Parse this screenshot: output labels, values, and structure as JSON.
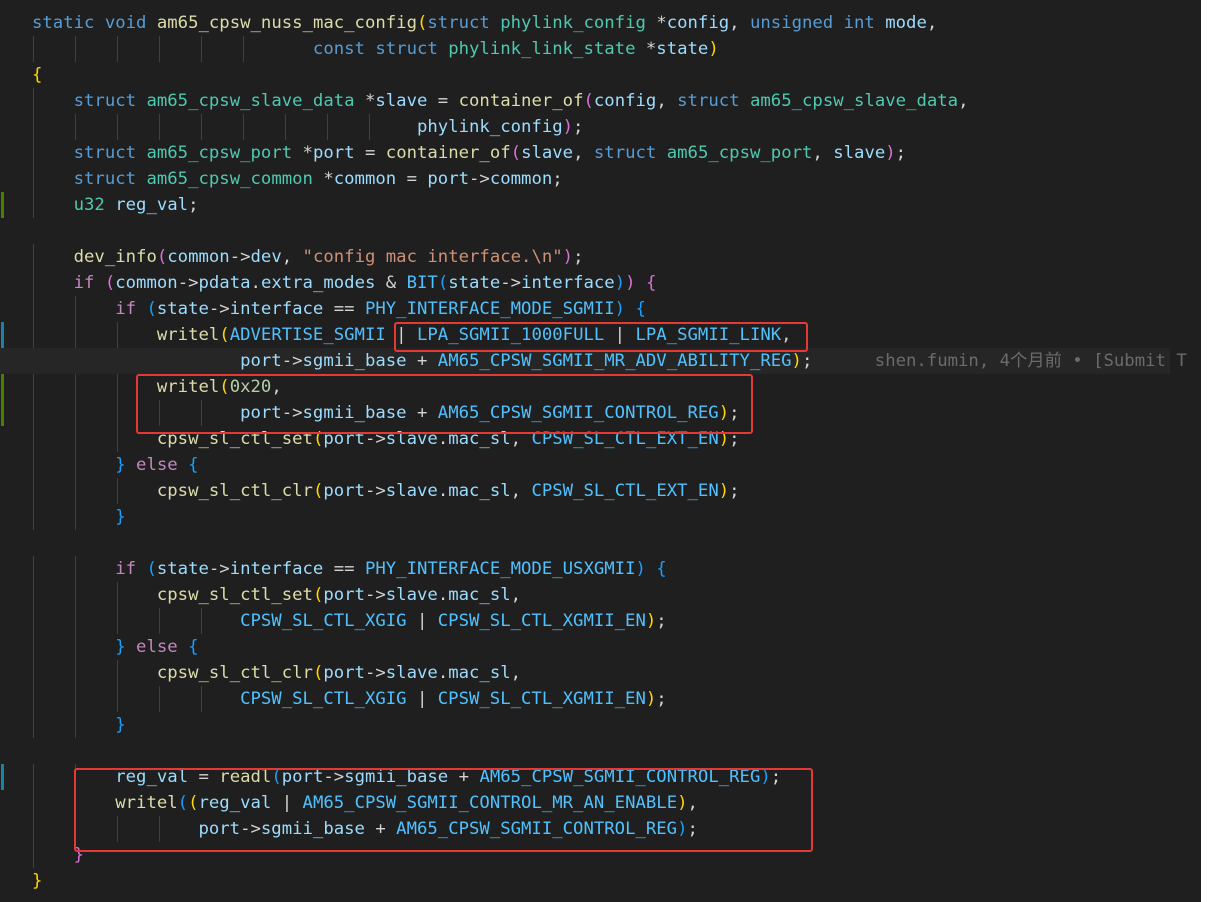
{
  "editor": {
    "language": "c",
    "theme": "dark",
    "blame_annotation": "shen.fumin, 4个月前 • [Submit T",
    "lines": [
      [
        [
          "kw",
          "static "
        ],
        [
          "kw",
          "void "
        ],
        [
          "fn",
          "am65_cpsw_nuss_mac_config"
        ],
        [
          "b1",
          "("
        ],
        [
          "kw",
          "struct "
        ],
        [
          "ty",
          "phylink_config "
        ],
        [
          "op",
          "*"
        ],
        [
          "var",
          "config"
        ],
        [
          "op",
          ", "
        ],
        [
          "kw",
          "unsigned "
        ],
        [
          "kw",
          "int "
        ],
        [
          "var",
          "mode"
        ],
        [
          "op",
          ","
        ]
      ],
      [
        [
          "op",
          "                           "
        ],
        [
          "kw",
          "const "
        ],
        [
          "kw",
          "struct "
        ],
        [
          "ty",
          "phylink_link_state "
        ],
        [
          "op",
          "*"
        ],
        [
          "var",
          "state"
        ],
        [
          "b1",
          ")"
        ]
      ],
      [
        [
          "b1",
          "{"
        ]
      ],
      [
        [
          "op",
          "    "
        ],
        [
          "kw",
          "struct "
        ],
        [
          "ty",
          "am65_cpsw_slave_data "
        ],
        [
          "op",
          "*"
        ],
        [
          "var",
          "slave"
        ],
        [
          "op",
          " = "
        ],
        [
          "fn",
          "container_of"
        ],
        [
          "b2",
          "("
        ],
        [
          "var",
          "config"
        ],
        [
          "op",
          ", "
        ],
        [
          "kw",
          "struct "
        ],
        [
          "ty",
          "am65_cpsw_slave_data"
        ],
        [
          "op",
          ","
        ]
      ],
      [
        [
          "op",
          "                                     "
        ],
        [
          "var",
          "phylink_config"
        ],
        [
          "b2",
          ")"
        ],
        [
          "op",
          ";"
        ]
      ],
      [
        [
          "op",
          "    "
        ],
        [
          "kw",
          "struct "
        ],
        [
          "ty",
          "am65_cpsw_port "
        ],
        [
          "op",
          "*"
        ],
        [
          "var",
          "port"
        ],
        [
          "op",
          " = "
        ],
        [
          "fn",
          "container_of"
        ],
        [
          "b2",
          "("
        ],
        [
          "var",
          "slave"
        ],
        [
          "op",
          ", "
        ],
        [
          "kw",
          "struct "
        ],
        [
          "ty",
          "am65_cpsw_port"
        ],
        [
          "op",
          ", "
        ],
        [
          "var",
          "slave"
        ],
        [
          "b2",
          ")"
        ],
        [
          "op",
          ";"
        ]
      ],
      [
        [
          "op",
          "    "
        ],
        [
          "kw",
          "struct "
        ],
        [
          "ty",
          "am65_cpsw_common "
        ],
        [
          "op",
          "*"
        ],
        [
          "var",
          "common"
        ],
        [
          "op",
          " = "
        ],
        [
          "var",
          "port"
        ],
        [
          "op",
          "->"
        ],
        [
          "var",
          "common"
        ],
        [
          "op",
          ";"
        ]
      ],
      [
        [
          "op",
          "    "
        ],
        [
          "ty",
          "u32 "
        ],
        [
          "var",
          "reg_val"
        ],
        [
          "op",
          ";"
        ]
      ],
      [],
      [
        [
          "op",
          "    "
        ],
        [
          "fn",
          "dev_info"
        ],
        [
          "b2",
          "("
        ],
        [
          "var",
          "common"
        ],
        [
          "op",
          "->"
        ],
        [
          "var",
          "dev"
        ],
        [
          "op",
          ", "
        ],
        [
          "str",
          "\"config mac interface.\\n\""
        ],
        [
          "b2",
          ")"
        ],
        [
          "op",
          ";"
        ]
      ],
      [
        [
          "op",
          "    "
        ],
        [
          "ctl",
          "if "
        ],
        [
          "b2",
          "("
        ],
        [
          "var",
          "common"
        ],
        [
          "op",
          "->"
        ],
        [
          "var",
          "pdata"
        ],
        [
          "op",
          "."
        ],
        [
          "var",
          "extra_modes"
        ],
        [
          "op",
          " & "
        ],
        [
          "mac",
          "BIT"
        ],
        [
          "b3",
          "("
        ],
        [
          "var",
          "state"
        ],
        [
          "op",
          "->"
        ],
        [
          "var",
          "interface"
        ],
        [
          "b3",
          ")"
        ],
        [
          "b2",
          ")"
        ],
        [
          "op",
          " "
        ],
        [
          "b2",
          "{"
        ]
      ],
      [
        [
          "op",
          "        "
        ],
        [
          "ctl",
          "if "
        ],
        [
          "b3",
          "("
        ],
        [
          "var",
          "state"
        ],
        [
          "op",
          "->"
        ],
        [
          "var",
          "interface"
        ],
        [
          "op",
          " == "
        ],
        [
          "mac",
          "PHY_INTERFACE_MODE_SGMII"
        ],
        [
          "b3",
          ")"
        ],
        [
          "op",
          " "
        ],
        [
          "b3",
          "{"
        ]
      ],
      [
        [
          "op",
          "            "
        ],
        [
          "fn",
          "writel"
        ],
        [
          "b1",
          "("
        ],
        [
          "mac",
          "ADVERTISE_SGMII"
        ],
        [
          "op",
          " | "
        ],
        [
          "mac",
          "LPA_SGMII_1000FULL"
        ],
        [
          "op",
          " | "
        ],
        [
          "mac",
          "LPA_SGMII_LINK"
        ],
        [
          "op",
          ","
        ]
      ],
      [
        [
          "op",
          "                    "
        ],
        [
          "var",
          "port"
        ],
        [
          "op",
          "->"
        ],
        [
          "var",
          "sgmii_base"
        ],
        [
          "op",
          " + "
        ],
        [
          "mac",
          "AM65_CPSW_SGMII_MR_ADV_ABILITY_REG"
        ],
        [
          "b1",
          ")"
        ],
        [
          "op",
          ";"
        ]
      ],
      [
        [
          "op",
          "            "
        ],
        [
          "fn",
          "writel"
        ],
        [
          "b1",
          "("
        ],
        [
          "num",
          "0x20"
        ],
        [
          "op",
          ","
        ]
      ],
      [
        [
          "op",
          "                    "
        ],
        [
          "var",
          "port"
        ],
        [
          "op",
          "->"
        ],
        [
          "var",
          "sgmii_base"
        ],
        [
          "op",
          " + "
        ],
        [
          "mac",
          "AM65_CPSW_SGMII_CONTROL_REG"
        ],
        [
          "b1",
          ")"
        ],
        [
          "op",
          ";"
        ]
      ],
      [
        [
          "op",
          "            "
        ],
        [
          "fn",
          "cpsw_sl_ctl_set"
        ],
        [
          "b1",
          "("
        ],
        [
          "var",
          "port"
        ],
        [
          "op",
          "->"
        ],
        [
          "var",
          "slave"
        ],
        [
          "op",
          "."
        ],
        [
          "var",
          "mac_sl"
        ],
        [
          "op",
          ", "
        ],
        [
          "mac",
          "CPSW_SL_CTL_EXT_EN"
        ],
        [
          "b1",
          ")"
        ],
        [
          "op",
          ";"
        ]
      ],
      [
        [
          "op",
          "        "
        ],
        [
          "b3",
          "}"
        ],
        [
          "op",
          " "
        ],
        [
          "ctl",
          "else "
        ],
        [
          "b3",
          "{"
        ]
      ],
      [
        [
          "op",
          "            "
        ],
        [
          "fn",
          "cpsw_sl_ctl_clr"
        ],
        [
          "b1",
          "("
        ],
        [
          "var",
          "port"
        ],
        [
          "op",
          "->"
        ],
        [
          "var",
          "slave"
        ],
        [
          "op",
          "."
        ],
        [
          "var",
          "mac_sl"
        ],
        [
          "op",
          ", "
        ],
        [
          "mac",
          "CPSW_SL_CTL_EXT_EN"
        ],
        [
          "b1",
          ")"
        ],
        [
          "op",
          ";"
        ]
      ],
      [
        [
          "op",
          "        "
        ],
        [
          "b3",
          "}"
        ]
      ],
      [],
      [
        [
          "op",
          "        "
        ],
        [
          "ctl",
          "if "
        ],
        [
          "b3",
          "("
        ],
        [
          "var",
          "state"
        ],
        [
          "op",
          "->"
        ],
        [
          "var",
          "interface"
        ],
        [
          "op",
          " == "
        ],
        [
          "mac",
          "PHY_INTERFACE_MODE_USXGMII"
        ],
        [
          "b3",
          ")"
        ],
        [
          "op",
          " "
        ],
        [
          "b3",
          "{"
        ]
      ],
      [
        [
          "op",
          "            "
        ],
        [
          "fn",
          "cpsw_sl_ctl_set"
        ],
        [
          "b1",
          "("
        ],
        [
          "var",
          "port"
        ],
        [
          "op",
          "->"
        ],
        [
          "var",
          "slave"
        ],
        [
          "op",
          "."
        ],
        [
          "var",
          "mac_sl"
        ],
        [
          "op",
          ","
        ]
      ],
      [
        [
          "op",
          "                    "
        ],
        [
          "mac",
          "CPSW_SL_CTL_XGIG"
        ],
        [
          "op",
          " | "
        ],
        [
          "mac",
          "CPSW_SL_CTL_XGMII_EN"
        ],
        [
          "b1",
          ")"
        ],
        [
          "op",
          ";"
        ]
      ],
      [
        [
          "op",
          "        "
        ],
        [
          "b3",
          "}"
        ],
        [
          "op",
          " "
        ],
        [
          "ctl",
          "else "
        ],
        [
          "b3",
          "{"
        ]
      ],
      [
        [
          "op",
          "            "
        ],
        [
          "fn",
          "cpsw_sl_ctl_clr"
        ],
        [
          "b1",
          "("
        ],
        [
          "var",
          "port"
        ],
        [
          "op",
          "->"
        ],
        [
          "var",
          "slave"
        ],
        [
          "op",
          "."
        ],
        [
          "var",
          "mac_sl"
        ],
        [
          "op",
          ","
        ]
      ],
      [
        [
          "op",
          "                    "
        ],
        [
          "mac",
          "CPSW_SL_CTL_XGIG"
        ],
        [
          "op",
          " | "
        ],
        [
          "mac",
          "CPSW_SL_CTL_XGMII_EN"
        ],
        [
          "b1",
          ")"
        ],
        [
          "op",
          ";"
        ]
      ],
      [
        [
          "op",
          "        "
        ],
        [
          "b3",
          "}"
        ]
      ],
      [],
      [
        [
          "op",
          "        "
        ],
        [
          "var",
          "reg_val"
        ],
        [
          "op",
          " = "
        ],
        [
          "fn",
          "readl"
        ],
        [
          "b3",
          "("
        ],
        [
          "var",
          "port"
        ],
        [
          "op",
          "->"
        ],
        [
          "var",
          "sgmii_base"
        ],
        [
          "op",
          " + "
        ],
        [
          "mac",
          "AM65_CPSW_SGMII_CONTROL_REG"
        ],
        [
          "b3",
          ")"
        ],
        [
          "op",
          ";"
        ]
      ],
      [
        [
          "op",
          "        "
        ],
        [
          "fn",
          "writel"
        ],
        [
          "b3",
          "("
        ],
        [
          "b1",
          "("
        ],
        [
          "var",
          "reg_val"
        ],
        [
          "op",
          " | "
        ],
        [
          "mac",
          "AM65_CPSW_SGMII_CONTROL_MR_AN_ENABLE"
        ],
        [
          "b1",
          ")"
        ],
        [
          "op",
          ","
        ]
      ],
      [
        [
          "op",
          "                "
        ],
        [
          "var",
          "port"
        ],
        [
          "op",
          "->"
        ],
        [
          "var",
          "sgmii_base"
        ],
        [
          "op",
          " + "
        ],
        [
          "mac",
          "AM65_CPSW_SGMII_CONTROL_REG"
        ],
        [
          "b3",
          ")"
        ],
        [
          "op",
          ";"
        ]
      ],
      [
        [
          "op",
          "    "
        ],
        [
          "b2",
          "}"
        ]
      ],
      [
        [
          "b1",
          "}"
        ]
      ]
    ]
  }
}
